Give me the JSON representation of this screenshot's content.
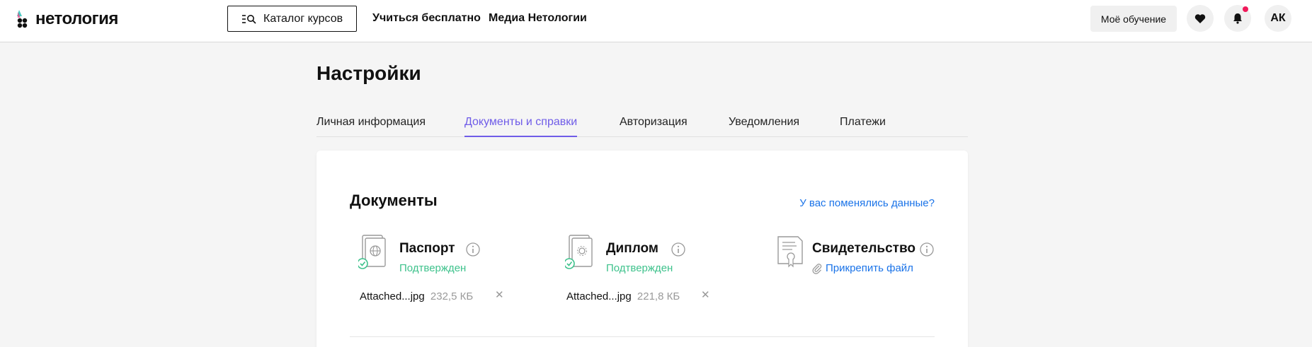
{
  "header": {
    "logo_text": "нетология",
    "catalog_label": "Каталог курсов",
    "nav": [
      "Учиться бесплатно",
      "Медиа Нетологии"
    ],
    "my_learning_label": "Моё обучение",
    "avatar_initials": "АК"
  },
  "page": {
    "title": "Настройки",
    "tabs": [
      "Личная информация",
      "Документы и справки",
      "Авторизация",
      "Уведомления",
      "Платежи"
    ],
    "active_tab": "Документы и справки"
  },
  "documents": {
    "title": "Документы",
    "changed_link": "У вас поменялись данные?",
    "items": [
      {
        "name": "Паспорт",
        "status": "Подтвержден",
        "file_name": "Attached...jpg",
        "file_size": "232,5 КБ",
        "icon": "passport-icon"
      },
      {
        "name": "Диплом",
        "status": "Подтвержден",
        "file_name": "Attached...jpg",
        "file_size": "221,8 КБ",
        "icon": "diploma-icon"
      },
      {
        "name": "Свидетельство",
        "action": "Прикрепить файл",
        "icon": "certificate-icon"
      }
    ]
  },
  "colors": {
    "accent": "#6f5ce8",
    "link": "#1a73e8",
    "success": "#3ec28c",
    "notification": "#f0195a"
  }
}
